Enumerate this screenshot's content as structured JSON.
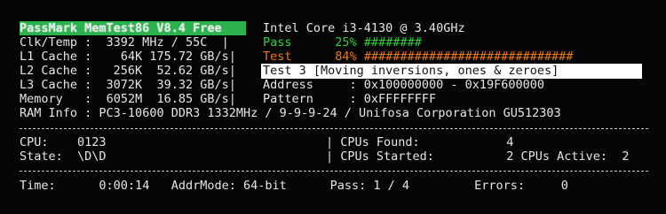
{
  "header": {
    "title": "PassMark MemTest86 V8.4 Free",
    "cpu": "Intel Core i3-4130 @ 3.40GHz"
  },
  "system": {
    "clk_temp": {
      "label": "Clk/Temp",
      "value": "3392 MHz / 55C"
    },
    "l1": {
      "label": "L1 Cache",
      "size": "64K",
      "speed": "175.72 GB/s"
    },
    "l2": {
      "label": "L2 Cache",
      "size": "256K",
      "speed": "52.62 GB/s"
    },
    "l3": {
      "label": "L3 Cache",
      "size": "3072K",
      "speed": "39.32 GB/s"
    },
    "memory": {
      "label": "Memory",
      "size": "6052M",
      "speed": "16.85 GB/s"
    },
    "ram_info": {
      "label": "RAM Info",
      "value": "PC3-10600 DDR3 1332MHz / 9-9-9-24 / Unifosa Corporation GU512303"
    }
  },
  "progress": {
    "pass_label": "Pass",
    "pass_pct": "25%",
    "pass_bar": "########",
    "pass_fraction": 0.25,
    "test_label": "Test",
    "test_pct": "84%",
    "test_bar": "#############################",
    "test_fraction": 0.84,
    "test_desc": "Test 3 [Moving inversions, ones & zeroes]",
    "address_label": "Address",
    "address_value": ": 0x100000000 - 0x19F600000",
    "pattern_label": "Pattern",
    "pattern_value": ": 0xFFFFFFFF"
  },
  "status": {
    "cpu_label": "CPU:",
    "cpu_value": "0123",
    "state_label": "State:",
    "state_value": "\\D\\D",
    "cpus_found_label": "CPUs Found:",
    "cpus_found_value": "4",
    "cpus_started_label": "CPUs Started:",
    "cpus_started_value": "2",
    "cpus_active_label": "CPUs Active:",
    "cpus_active_value": "2"
  },
  "footer": {
    "time_label": "Time:",
    "time_value": "0:00:14",
    "addrmode_label": "AddrMode:",
    "addrmode_value": "64-bit",
    "pass_label": "Pass:",
    "pass_value": "1 / 4",
    "errors_label": "Errors:",
    "errors_value": "0"
  },
  "colors": {
    "title_bg": "#2bb24c",
    "pass_green": "#2bd03d",
    "test_orange": "#f07b12",
    "background": "#050505",
    "text": "#e6e6e6"
  }
}
